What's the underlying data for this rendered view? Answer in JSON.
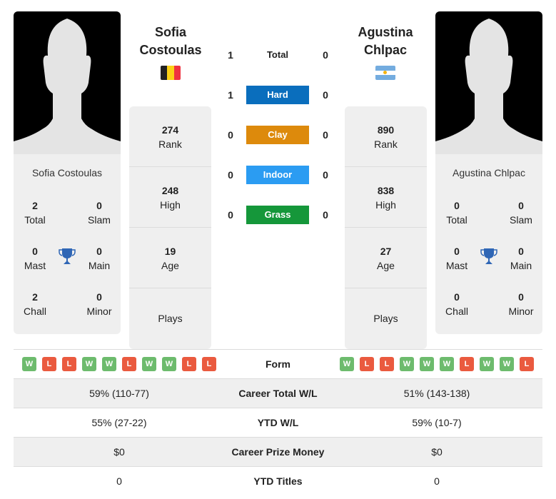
{
  "players": [
    {
      "name": "Sofia Costoulas",
      "name_line1": "Sofia",
      "name_line2": "Costoulas",
      "flag": "belgium-flag",
      "rank": "274",
      "rank_label": "Rank",
      "high": "248",
      "high_label": "High",
      "age": "19",
      "age_label": "Age",
      "plays_label": "Plays",
      "titles": {
        "total": "2",
        "slam": "0",
        "mast": "0",
        "main": "0",
        "chall": "2",
        "minor": "0"
      }
    },
    {
      "name": "Agustina Chlpac",
      "name_line1": "Agustina",
      "name_line2": "Chlpac",
      "flag": "argentina-flag",
      "rank": "890",
      "rank_label": "Rank",
      "high": "838",
      "high_label": "High",
      "age": "27",
      "age_label": "Age",
      "plays_label": "Plays",
      "titles": {
        "total": "0",
        "slam": "0",
        "mast": "0",
        "main": "0",
        "chall": "0",
        "minor": "0"
      }
    }
  ],
  "title_labels": {
    "total": "Total",
    "slam": "Slam",
    "mast": "Mast",
    "main": "Main",
    "chall": "Chall",
    "minor": "Minor"
  },
  "h2h": [
    {
      "label": "Total",
      "p1": "1",
      "p2": "0",
      "color": null
    },
    {
      "label": "Hard",
      "p1": "1",
      "p2": "0",
      "color": "#0a6ebd"
    },
    {
      "label": "Clay",
      "p1": "0",
      "p2": "0",
      "color": "#dd8a0c"
    },
    {
      "label": "Indoor",
      "p1": "0",
      "p2": "0",
      "color": "#2b9cf2"
    },
    {
      "label": "Grass",
      "p1": "0",
      "p2": "0",
      "color": "#15973a"
    }
  ],
  "form": {
    "label": "Form",
    "p1": [
      "W",
      "L",
      "L",
      "W",
      "W",
      "L",
      "W",
      "W",
      "L",
      "L"
    ],
    "p2": [
      "W",
      "L",
      "L",
      "W",
      "W",
      "W",
      "L",
      "W",
      "W",
      "L"
    ]
  },
  "stats": [
    {
      "label": "Career Total W/L",
      "p1": "59% (110-77)",
      "p2": "51% (143-138)"
    },
    {
      "label": "YTD W/L",
      "p1": "55% (27-22)",
      "p2": "59% (10-7)"
    },
    {
      "label": "Career Prize Money",
      "p1": "$0",
      "p2": "$0"
    },
    {
      "label": "YTD Titles",
      "p1": "0",
      "p2": "0"
    }
  ]
}
